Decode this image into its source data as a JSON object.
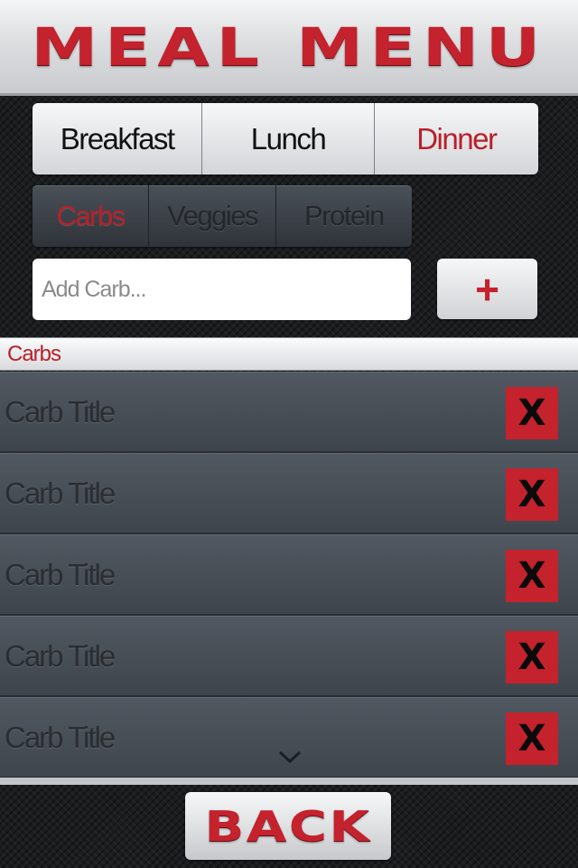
{
  "header": {
    "title": "MEAL MENU"
  },
  "meal_tabs": [
    {
      "label": "Breakfast",
      "active": false
    },
    {
      "label": "Lunch",
      "active": false
    },
    {
      "label": "Dinner",
      "active": true
    }
  ],
  "category_tabs": [
    {
      "label": "Carbs",
      "active": true
    },
    {
      "label": "Veggies",
      "active": false
    },
    {
      "label": "Protein",
      "active": false
    }
  ],
  "add_row": {
    "placeholder": "Add Carb...",
    "value": "",
    "add_label": "+"
  },
  "section": {
    "title": "Carbs"
  },
  "items": [
    {
      "title": "Carb Title",
      "delete_label": "X"
    },
    {
      "title": "Carb Title",
      "delete_label": "X"
    },
    {
      "title": "Carb Title",
      "delete_label": "X"
    },
    {
      "title": "Carb Title",
      "delete_label": "X"
    },
    {
      "title": "Carb Title",
      "delete_label": "X"
    }
  ],
  "footer": {
    "back_label": "BACK"
  },
  "icons": {
    "scroll_indicator": "chevron-down-icon"
  },
  "colors": {
    "accent": "#c4222d",
    "active_tab": "#b8202a",
    "list_bg": "#4a5058"
  }
}
